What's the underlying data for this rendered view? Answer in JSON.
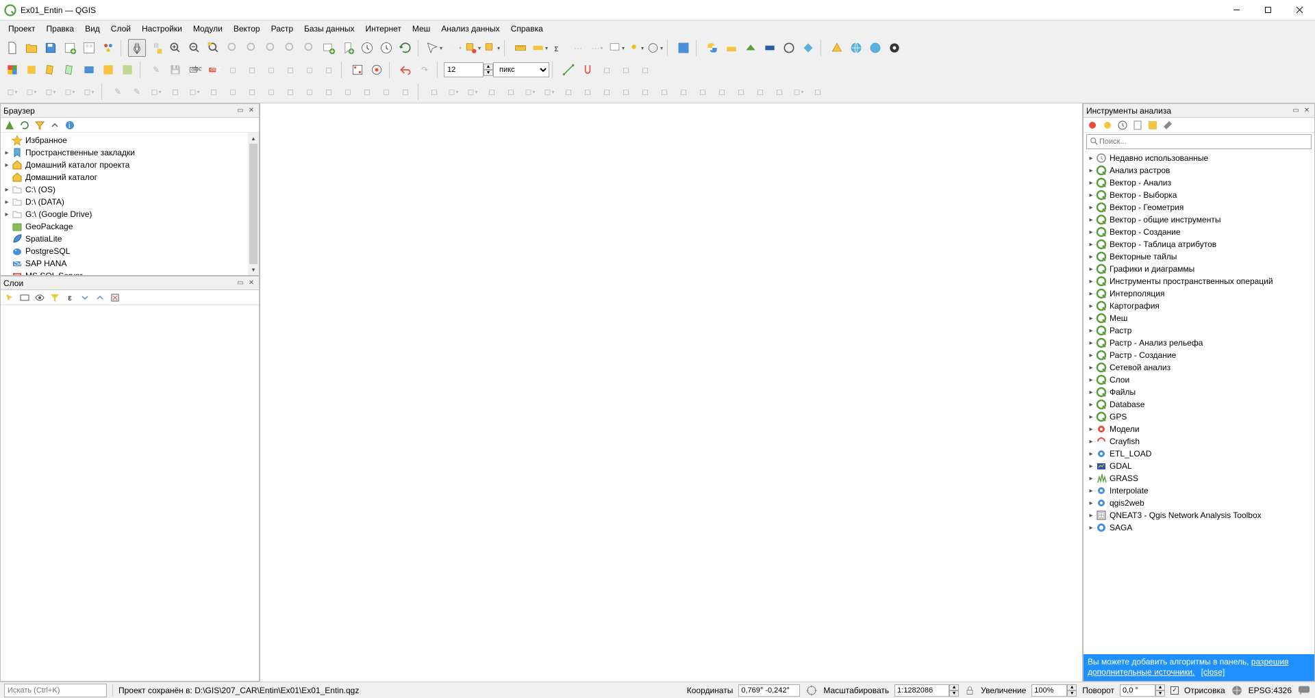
{
  "window": {
    "title": "Ex01_Entin — QGIS"
  },
  "menus": [
    "Проект",
    "Правка",
    "Вид",
    "Слой",
    "Настройки",
    "Модули",
    "Вектор",
    "Растр",
    "Базы данных",
    "Интернет",
    "Меш",
    "Анализ данных",
    "Справка"
  ],
  "toolbar_input": {
    "value": "12",
    "unit": "пикс"
  },
  "browser": {
    "title": "Браузер",
    "items": [
      {
        "exp": "",
        "icon": "star",
        "label": "Избранное"
      },
      {
        "exp": "▸",
        "icon": "bookmark",
        "label": "Пространственные закладки"
      },
      {
        "exp": "▸",
        "icon": "homefolder",
        "label": "Домашний каталог проекта"
      },
      {
        "exp": "",
        "icon": "homefolder",
        "label": "Домашний каталог"
      },
      {
        "exp": "▸",
        "icon": "folder",
        "label": "C:\\ (OS)"
      },
      {
        "exp": "▸",
        "icon": "folder",
        "label": "D:\\ (DATA)"
      },
      {
        "exp": "▸",
        "icon": "folder",
        "label": "G:\\ (Google Drive)"
      },
      {
        "exp": "",
        "icon": "geopackage",
        "label": "GeoPackage"
      },
      {
        "exp": "",
        "icon": "feather",
        "label": "SpatiaLite"
      },
      {
        "exp": "",
        "icon": "elephant",
        "label": "PostgreSQL"
      },
      {
        "exp": "",
        "icon": "sap",
        "label": "SAP HANA"
      },
      {
        "exp": "",
        "icon": "mssql",
        "label": "MS SQL Server"
      }
    ]
  },
  "layers": {
    "title": "Слои"
  },
  "processing": {
    "title": "Инструменты анализа",
    "search_placeholder": "Поиск...",
    "banner_text": "Вы можете добавить алгоритмы в панель, ",
    "banner_link1": "разрешив дополнительные источники.",
    "banner_link2": "[close]",
    "items": [
      {
        "icon": "clock",
        "label": "Недавно использованные"
      },
      {
        "icon": "q",
        "label": "Анализ растров"
      },
      {
        "icon": "q",
        "label": "Вектор - Анализ"
      },
      {
        "icon": "q",
        "label": "Вектор - Выборка"
      },
      {
        "icon": "q",
        "label": "Вектор - Геометрия"
      },
      {
        "icon": "q",
        "label": "Вектор - общие инструменты"
      },
      {
        "icon": "q",
        "label": "Вектор - Создание"
      },
      {
        "icon": "q",
        "label": "Вектор - Таблица атрибутов"
      },
      {
        "icon": "q",
        "label": "Векторные тайлы"
      },
      {
        "icon": "q",
        "label": "Графики и диаграммы"
      },
      {
        "icon": "q",
        "label": "Инструменты пространственных операций"
      },
      {
        "icon": "q",
        "label": "Интерполяция"
      },
      {
        "icon": "q",
        "label": "Картография"
      },
      {
        "icon": "q",
        "label": "Меш"
      },
      {
        "icon": "q",
        "label": "Растр"
      },
      {
        "icon": "q",
        "label": "Растр - Анализ рельефа"
      },
      {
        "icon": "q",
        "label": "Растр - Создание"
      },
      {
        "icon": "q",
        "label": "Сетевой анализ"
      },
      {
        "icon": "q",
        "label": "Слои"
      },
      {
        "icon": "q",
        "label": "Файлы"
      },
      {
        "icon": "q",
        "label": "Database"
      },
      {
        "icon": "q",
        "label": "GPS"
      },
      {
        "icon": "gear-red",
        "label": "Модели"
      },
      {
        "icon": "crayfish",
        "label": "Crayfish"
      },
      {
        "icon": "gear-blue",
        "label": "ETL_LOAD"
      },
      {
        "icon": "gdal",
        "label": "GDAL"
      },
      {
        "icon": "grass",
        "label": "GRASS"
      },
      {
        "icon": "gear-blue",
        "label": "Interpolate"
      },
      {
        "icon": "gear-blue",
        "label": "qgis2web"
      },
      {
        "icon": "qneat",
        "label": "QNEAT3 - Qgis Network Analysis Toolbox"
      },
      {
        "icon": "saga",
        "label": "SAGA"
      }
    ]
  },
  "status": {
    "search_placeholder": "Искать (Ctrl+K)",
    "message": "Проект сохранён в: D:\\GIS\\207_CAR\\Entin\\Ex01\\Ex01_Entin.qgz",
    "coord_label": "Координаты",
    "coord_value": "0,769° -0,242°",
    "scale_label": "Масштабировать",
    "scale_value": "1:1282086",
    "zoom_label": "Увеличение",
    "zoom_value": "100%",
    "rotation_label": "Поворот",
    "rotation_value": "0,0 °",
    "render_label": "Отрисовка",
    "crs": "EPSG:4326"
  }
}
